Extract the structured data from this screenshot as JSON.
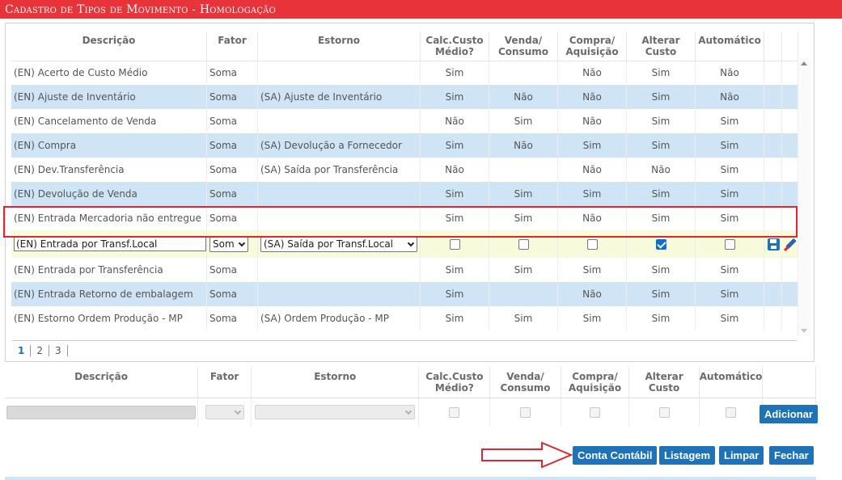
{
  "window": {
    "title": "Cadastro de Tipos de Movimento  - Homologação"
  },
  "columns": [
    "Descrição",
    "Fator",
    "Estorno",
    "Calc.Custo Médio?",
    "Venda/ Consumo",
    "Compra/ Aquisição",
    "Alterar Custo",
    "Automático"
  ],
  "rows": [
    {
      "descricao": "(EN) Acerto de Custo Médio",
      "fator": "Soma",
      "estorno": "",
      "calc": "Sim",
      "venda": "",
      "compra": "Não",
      "alterar": "Sim",
      "auto": "Não"
    },
    {
      "descricao": "(EN) Ajuste de Inventário",
      "fator": "Soma",
      "estorno": "(SA) Ajuste de Inventário",
      "calc": "Sim",
      "venda": "Não",
      "compra": "Não",
      "alterar": "Sim",
      "auto": "Não"
    },
    {
      "descricao": "(EN) Cancelamento de Venda",
      "fator": "Soma",
      "estorno": "",
      "calc": "Não",
      "venda": "Sim",
      "compra": "Não",
      "alterar": "Sim",
      "auto": "Sim"
    },
    {
      "descricao": "(EN) Compra",
      "fator": "Soma",
      "estorno": "(SA) Devolução a Fornecedor",
      "calc": "Sim",
      "venda": "Não",
      "compra": "Sim",
      "alterar": "Sim",
      "auto": "Sim"
    },
    {
      "descricao": "(EN) Dev.Transferência",
      "fator": "Soma",
      "estorno": "(SA) Saída por Transferência",
      "calc": "Não",
      "venda": "",
      "compra": "Não",
      "alterar": "Não",
      "auto": "Sim"
    },
    {
      "descricao": "(EN) Devolução de Venda",
      "fator": "Soma",
      "estorno": "",
      "calc": "Sim",
      "venda": "Sim",
      "compra": "Sim",
      "alterar": "Sim",
      "auto": "Sim"
    },
    {
      "descricao": "(EN) Entrada Mercadoria não entregue",
      "fator": "Soma",
      "estorno": "",
      "calc": "Sim",
      "venda": "Sim",
      "compra": "Não",
      "alterar": "Sim",
      "auto": "Sim"
    }
  ],
  "edit_row": {
    "descricao": "(EN) Entrada por Transf.Local",
    "fator": "Som",
    "estorno": "(SA) Saída por Transf.Local",
    "calc_checked": false,
    "venda_checked": false,
    "compra_checked": false,
    "alterar_checked": true,
    "auto_checked": false
  },
  "rows_after": [
    {
      "descricao": "(EN) Entrada por Transferência",
      "fator": "Soma",
      "estorno": "",
      "calc": "Sim",
      "venda": "Sim",
      "compra": "Sim",
      "alterar": "Sim",
      "auto": "Sim"
    },
    {
      "descricao": "(EN) Entrada Retorno de embalagem",
      "fator": "Soma",
      "estorno": "",
      "calc": "Sim",
      "venda": "",
      "compra": "Não",
      "alterar": "Sim",
      "auto": "Sim"
    },
    {
      "descricao": "(EN) Estorno Ordem Produção - MP",
      "fator": "Soma",
      "estorno": "(SA) Ordem Produção - MP",
      "calc": "Sim",
      "venda": "Sim",
      "compra": "Sim",
      "alterar": "Sim",
      "auto": "Sim"
    }
  ],
  "pager": {
    "pages": [
      "1",
      "2",
      "3"
    ],
    "active": "1"
  },
  "form": {
    "headers": [
      "Descrição",
      "Fator",
      "Estorno",
      "Calc.Custo Médio?",
      "Venda/ Consumo",
      "Compra/ Aquisição",
      "Alterar Custo",
      "Automático"
    ],
    "add_label": "Adicionar"
  },
  "buttons": {
    "conta": "Conta Contábil",
    "listagem": "Listagem",
    "limpar": "Limpar",
    "fechar": "Fechar"
  },
  "colors": {
    "title_bar": "#e8333a",
    "accent": "#1d72b8",
    "row_alt": "#cfe4f4",
    "edit_row": "#f7fbdc",
    "highlight": "#e0262f"
  }
}
